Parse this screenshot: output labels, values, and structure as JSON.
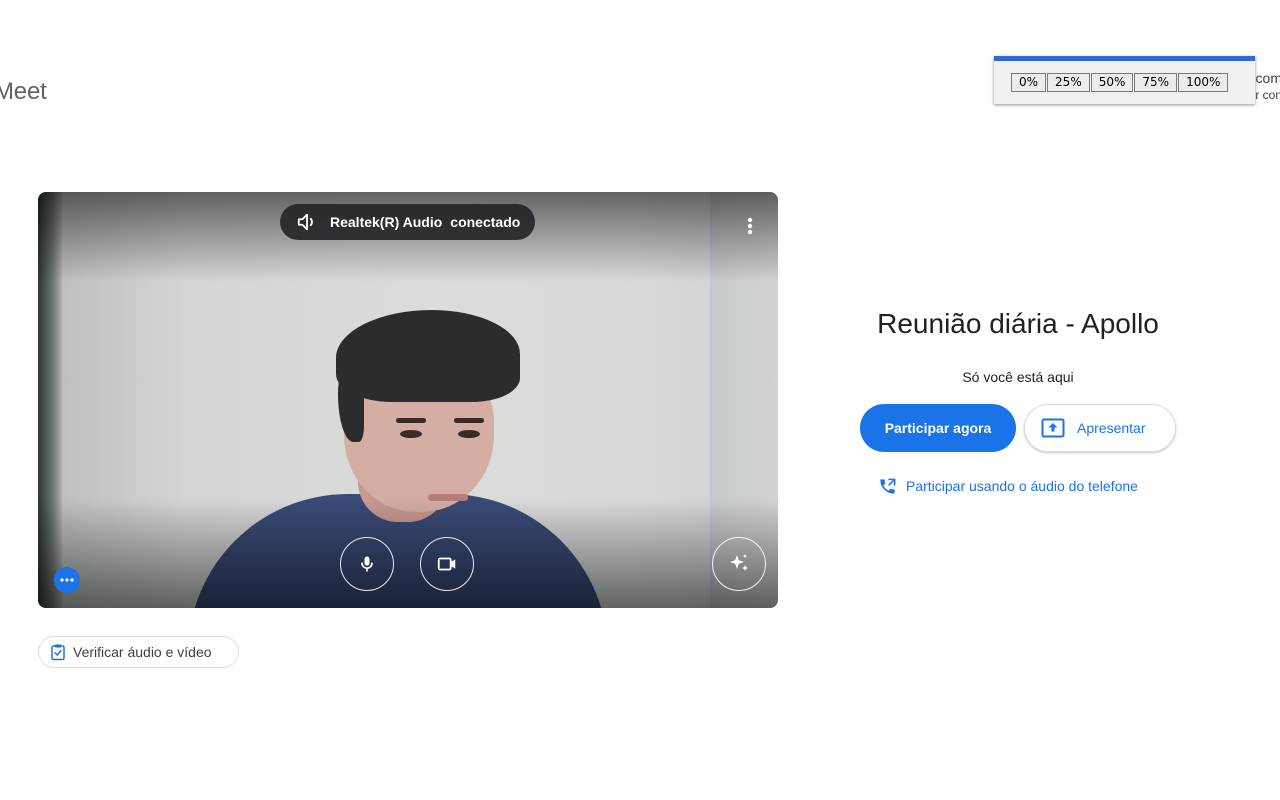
{
  "header": {
    "logo_text": "Meet",
    "edge_text_line1": "com",
    "edge_text_line2": "r con"
  },
  "zoom_popup": {
    "options": [
      "0%",
      "25%",
      "50%",
      "75%",
      "100%"
    ],
    "accent_color": "#3367d6"
  },
  "video_preview": {
    "audio_device": "Realtek(R) Audio",
    "audio_status": "conectado",
    "icons": {
      "speaker": "speaker-icon",
      "more_options": "more-vert-icon",
      "microphone": "mic-icon",
      "camera": "videocam-icon",
      "effects": "sparkle-icon",
      "more_actions": "more-horiz-icon"
    }
  },
  "check_av": {
    "label": "Verificar áudio e vídeo",
    "icon": "clipboard-check-icon"
  },
  "meeting": {
    "title": "Reunião diária - Apollo",
    "presence": "Só você está aqui",
    "join_label": "Participar agora",
    "present_label": "Apresentar",
    "phone_label": "Participar usando o áudio do telefone",
    "accent_color": "#1a73e8"
  }
}
